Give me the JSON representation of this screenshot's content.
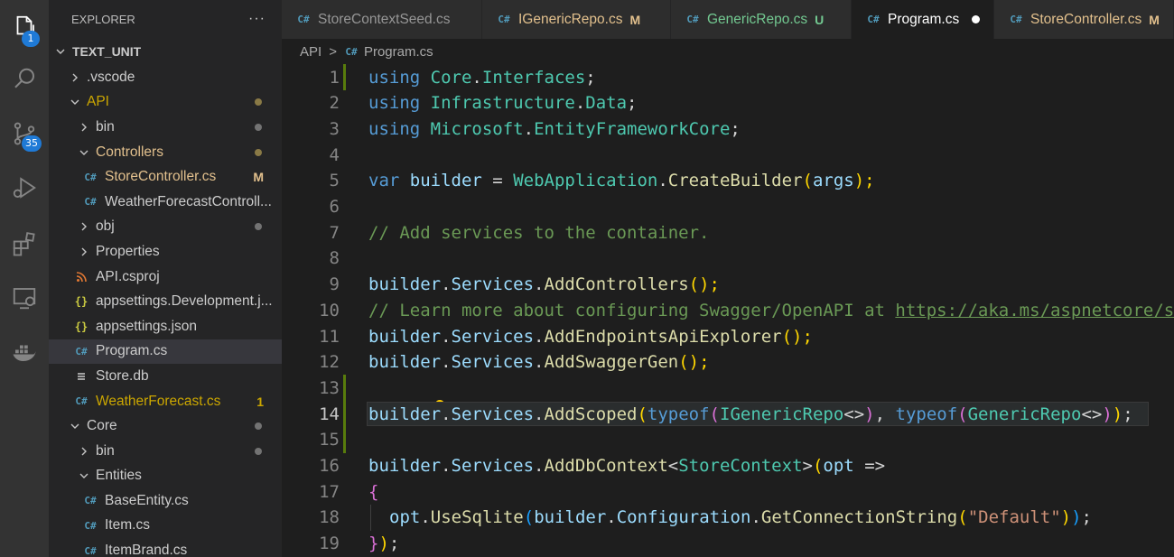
{
  "activity_bar": {
    "explorer_badge": "1",
    "scm_badge": "35"
  },
  "sidebar": {
    "title": "EXPLORER",
    "more": "···",
    "root": "TEXT_UNIT",
    "items": [
      {
        "label": ".vscode"
      },
      {
        "label": "API"
      },
      {
        "label": "bin"
      },
      {
        "label": "Controllers"
      },
      {
        "label": "StoreController.cs",
        "badge": "M"
      },
      {
        "label": "WeatherForecastControll..."
      },
      {
        "label": "obj"
      },
      {
        "label": "Properties"
      },
      {
        "label": "API.csproj"
      },
      {
        "label": "appsettings.Development.j..."
      },
      {
        "label": "appsettings.json"
      },
      {
        "label": "Program.cs"
      },
      {
        "label": "Store.db"
      },
      {
        "label": "WeatherForecast.cs",
        "badge": "1"
      },
      {
        "label": "Core"
      },
      {
        "label": "bin"
      },
      {
        "label": "Entities"
      },
      {
        "label": "BaseEntity.cs"
      },
      {
        "label": "Item.cs"
      },
      {
        "label": "ItemBrand.cs"
      }
    ]
  },
  "tabs": [
    {
      "label": "StoreContextSeed.cs",
      "mark": ""
    },
    {
      "label": "IGenericRepo.cs",
      "mark": "M"
    },
    {
      "label": "GenericRepo.cs",
      "mark": "U"
    },
    {
      "label": "Program.cs",
      "mark": ""
    },
    {
      "label": "StoreController.cs",
      "mark": "M"
    }
  ],
  "breadcrumb": {
    "folder": "API",
    "file": "Program.cs"
  },
  "editor": {
    "line_numbers": [
      "1",
      "2",
      "3",
      "4",
      "5",
      "6",
      "7",
      "8",
      "9",
      "10",
      "11",
      "12",
      "13",
      "14",
      "15",
      "16",
      "17",
      "18",
      "19"
    ],
    "code": {
      "l1": [
        "using",
        " ",
        "Core",
        ".",
        "Interfaces",
        ";"
      ],
      "l2": [
        "using",
        " ",
        "Infrastructure",
        ".",
        "Data",
        ";"
      ],
      "l3": [
        "using",
        " ",
        "Microsoft",
        ".",
        "EntityFrameworkCore",
        ";"
      ],
      "l5": [
        "var",
        " ",
        "builder",
        " = ",
        "WebApplication",
        ".",
        "CreateBuilder",
        "(",
        "args",
        ");"
      ],
      "l7": "// Add services to the container.",
      "l9": [
        "builder",
        ".",
        "Services",
        ".",
        "AddControllers",
        "();"
      ],
      "l10": [
        "// Learn more about configuring Swagger/OpenAPI at ",
        "https://aka.ms/aspnetcore/swashbuckle"
      ],
      "l11": [
        "builder",
        ".",
        "Services",
        ".",
        "AddEndpointsApiExplorer",
        "();"
      ],
      "l12": [
        "builder",
        ".",
        "Services",
        ".",
        "AddSwaggerGen",
        "();"
      ],
      "l14": [
        "builder",
        ".",
        "Services",
        ".",
        "AddScoped",
        "(",
        "typeof",
        "(",
        "IGenericRepo",
        "<>",
        ")",
        ", ",
        "typeof",
        "(",
        "GenericRepo",
        "<>",
        ")",
        ")",
        ";"
      ],
      "l16": [
        "builder",
        ".",
        "Services",
        ".",
        "AddDbContext",
        "<",
        "StoreContext",
        ">",
        "(",
        "opt",
        " =>"
      ],
      "l17": "{",
      "l18": [
        "opt",
        ".",
        "UseSqlite",
        "(",
        "builder",
        ".",
        "Configuration",
        ".",
        "GetConnectionString",
        "(",
        "\"Default\"",
        ")",
        ")",
        ";"
      ],
      "l19": [
        "}",
        ")",
        ";"
      ]
    }
  },
  "colors": {
    "keyword": "#569cd6",
    "type": "#4ec9b0",
    "variable": "#9cdcfe",
    "function": "#dcdcaa",
    "comment": "#6a9955",
    "string": "#ce9178",
    "accent_badge": "#1f7ad6"
  }
}
